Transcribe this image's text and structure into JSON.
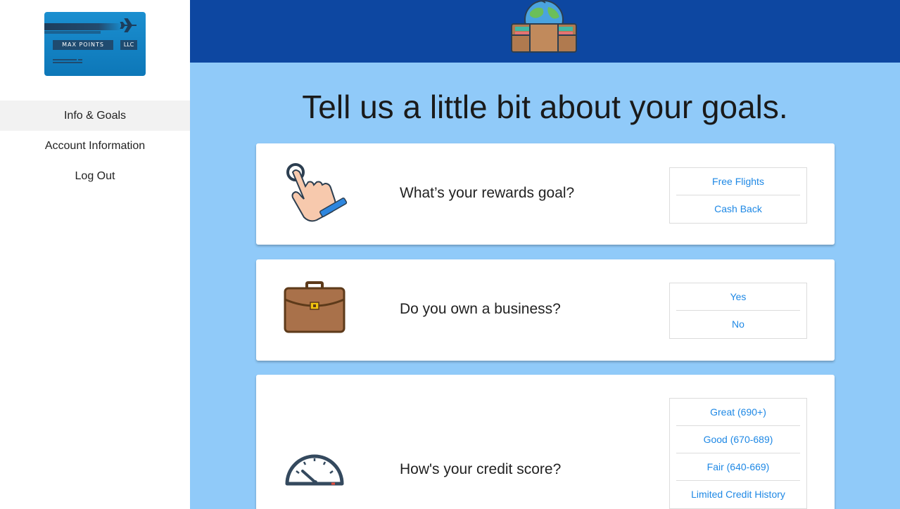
{
  "sidebar": {
    "logo": {
      "brand": "MAX POINTS",
      "suffix": "LLC"
    },
    "nav": [
      {
        "label": "Info & Goals",
        "active": true
      },
      {
        "label": "Account Information",
        "active": false
      },
      {
        "label": "Log Out",
        "active": false
      }
    ]
  },
  "header": {
    "icon": "wallet-globe-icon",
    "color": "#0d47a1"
  },
  "main": {
    "background": "#90caf9",
    "headline": "Tell us a little bit about your goals.",
    "questions": [
      {
        "icon": "pointing-hand-icon",
        "text": "What’s your rewards goal?",
        "options": [
          "Free Flights",
          "Cash Back"
        ]
      },
      {
        "icon": "briefcase-icon",
        "text": "Do you own a business?",
        "options": [
          "Yes",
          "No"
        ]
      },
      {
        "icon": "speedometer-icon",
        "text": "How's your credit score?",
        "options": [
          "Great (690+)",
          "Good (670-689)",
          "Fair (640-669)",
          "Limited Credit History"
        ]
      }
    ]
  },
  "colors": {
    "accent": "#1e88e5",
    "header": "#0d47a1",
    "main_bg": "#90caf9"
  }
}
